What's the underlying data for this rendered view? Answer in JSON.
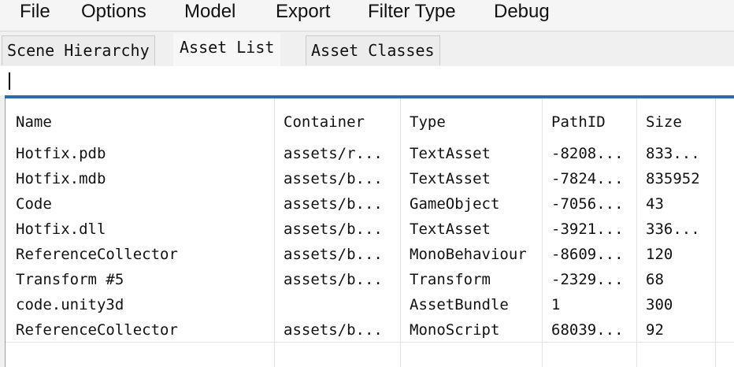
{
  "menu": [
    "File",
    "Options",
    "Model",
    "Export",
    "Filter Type",
    "Debug"
  ],
  "tabs": [
    {
      "label": "Scene Hierarchy",
      "active": false
    },
    {
      "label": "Asset List",
      "active": true
    },
    {
      "label": "Asset Classes",
      "active": false
    }
  ],
  "filter": {
    "value": ""
  },
  "table": {
    "columns": [
      "Name",
      "Container",
      "Type",
      "PathID",
      "Size"
    ],
    "rows": [
      [
        "Hotfix.pdb",
        "assets/r...",
        "TextAsset",
        "-8208...",
        "833..."
      ],
      [
        "Hotfix.mdb",
        "assets/b...",
        "TextAsset",
        "-7824...",
        "835952"
      ],
      [
        "Code",
        "assets/b...",
        "GameObject",
        "-7056...",
        "43"
      ],
      [
        "Hotfix.dll",
        "assets/b...",
        "TextAsset",
        "-3921...",
        "336..."
      ],
      [
        "ReferenceCollector",
        "assets/b...",
        "MonoBehaviour",
        "-8609...",
        "120"
      ],
      [
        "Transform #5",
        "assets/b...",
        "Transform",
        "-2329...",
        "68"
      ],
      [
        "code.unity3d",
        "",
        "AssetBundle",
        "1",
        "300"
      ],
      [
        "ReferenceCollector",
        "assets/b...",
        "MonoScript",
        "68039...",
        "92"
      ]
    ]
  }
}
